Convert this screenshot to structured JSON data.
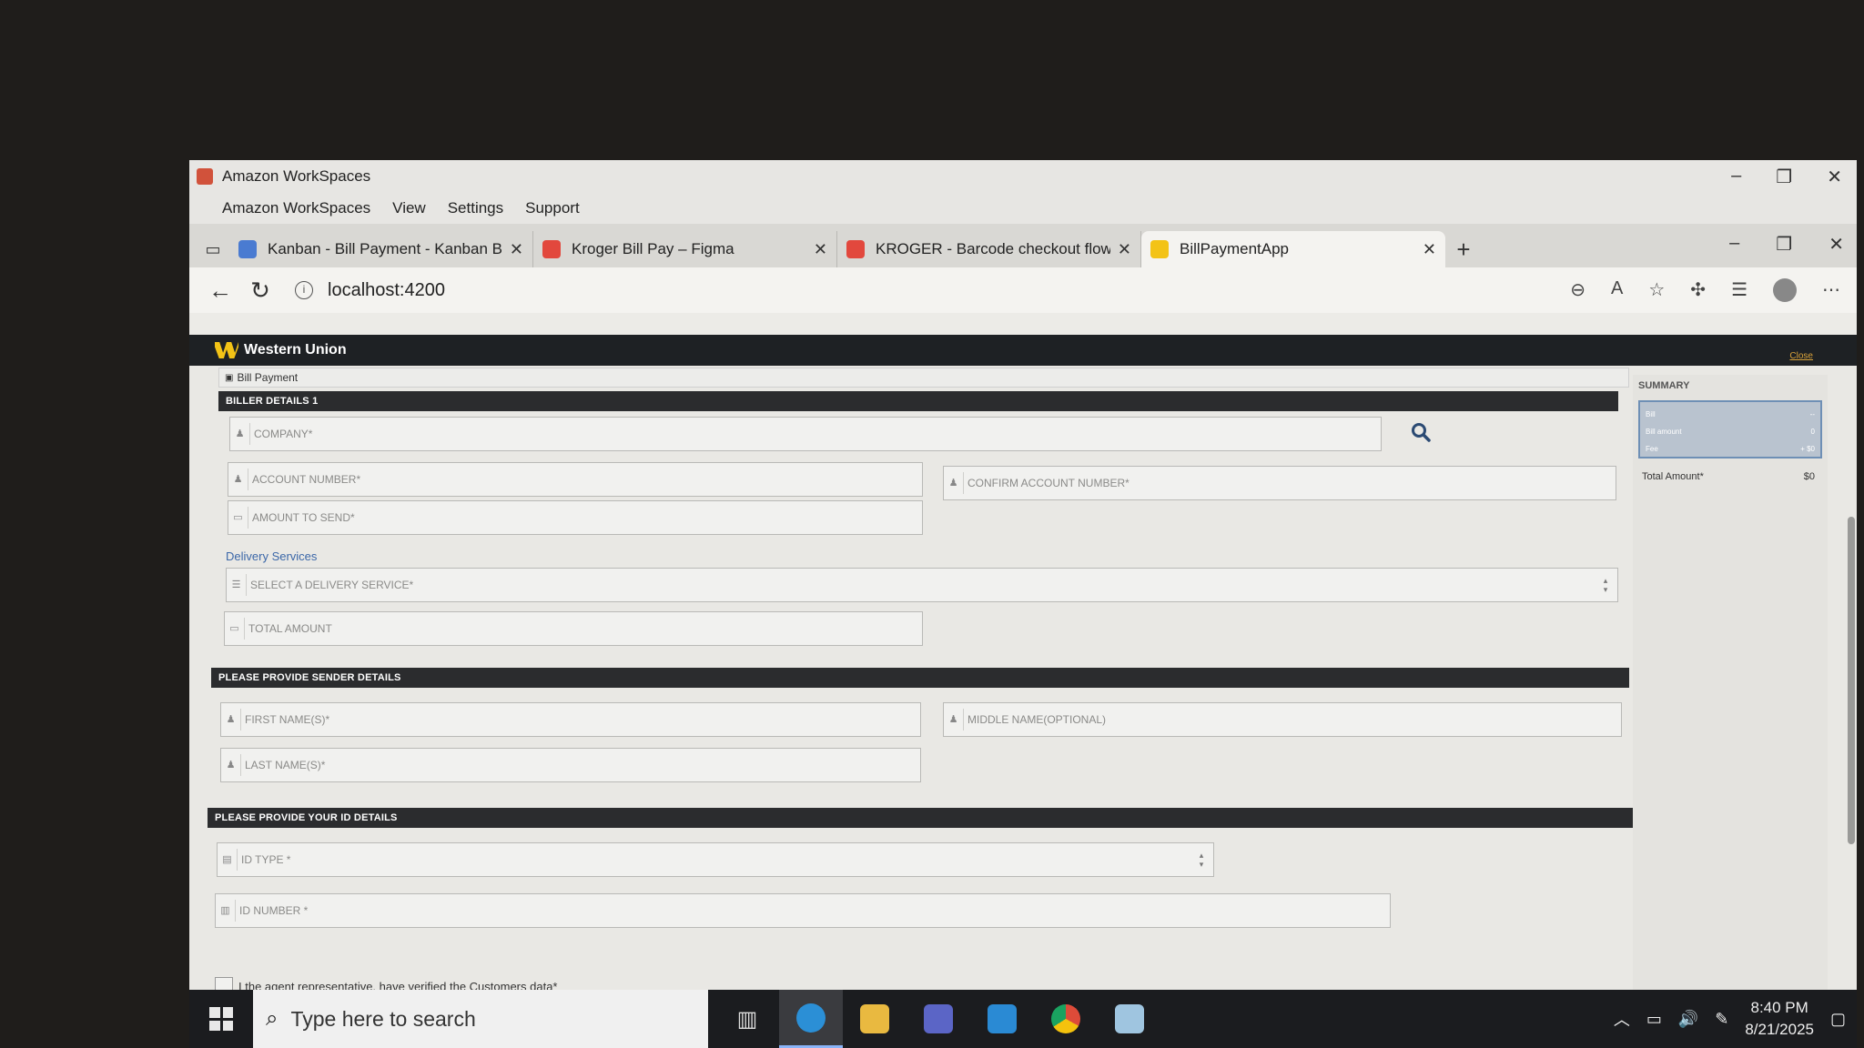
{
  "workspaces": {
    "title": "Amazon WorkSpaces",
    "menu": [
      "Amazon WorkSpaces",
      "View",
      "Settings",
      "Support"
    ]
  },
  "browser": {
    "tabs": [
      {
        "title": "Kanban - Bill Payment - Kanban B",
        "color": "#4a7bd1"
      },
      {
        "title": "Kroger Bill Pay – Figma",
        "color": "#e2483d"
      },
      {
        "title": "KROGER - Barcode checkout flow",
        "color": "#e2483d"
      },
      {
        "title": "BillPaymentApp",
        "color": "#f3c316"
      }
    ],
    "url": "localhost:4200"
  },
  "app": {
    "brand": "Western Union",
    "close_label": "Close",
    "breadcrumb": "Bill Payment",
    "sections": {
      "biller": "BILLER DETAILS 1",
      "sender": "PLEASE PROVIDE SENDER DETAILS",
      "id": "PLEASE PROVIDE YOUR ID DETAILS"
    },
    "fields": {
      "company": "COMPANY*",
      "account_number": "ACCOUNT NUMBER*",
      "confirm_account_number": "CONFIRM ACCOUNT NUMBER*",
      "amount_to_send": "AMOUNT TO SEND*",
      "delivery_services_label": "Delivery Services",
      "delivery_service": "SELECT A DELIVERY SERVICE*",
      "total_amount": "TOTAL AMOUNT",
      "first_name": "FIRST NAME(S)*",
      "middle_name": "MIDDLE NAME(OPTIONAL)",
      "last_name": "LAST NAME(S)*",
      "id_type": "ID TYPE *",
      "id_number": "ID NUMBER *"
    },
    "verification_label": "I the agent representative, have verified the Customers data*",
    "summary": {
      "title": "SUMMARY",
      "rows": [
        {
          "label": "Bill",
          "value": "--"
        },
        {
          "label": "Bill amount",
          "value": "0"
        },
        {
          "label": "Fee",
          "value": "+ $0"
        }
      ],
      "total_label": "Total Amount*",
      "total_value": "$0"
    }
  },
  "taskbar": {
    "search_placeholder": "Type here to search",
    "time": "8:40 PM",
    "date": "8/21/2025"
  }
}
